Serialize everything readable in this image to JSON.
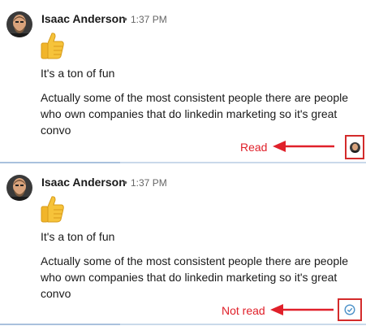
{
  "messages": [
    {
      "sender": "Isaac Anderson",
      "separator": "•",
      "time": "1:37 PM",
      "emoji_icon": "thumbs-up-icon",
      "line1": "It's a ton of fun",
      "line2": "Actually some of the most consistent people there are people who own companies that do linkedin marketing so it's great convo",
      "annotation": "Read",
      "receipt_icon": "read-receipt-avatar-icon"
    },
    {
      "sender": "Isaac Anderson",
      "separator": "•",
      "time": "1:37 PM",
      "emoji_icon": "thumbs-up-icon",
      "line1": "It's a ton of fun",
      "line2": "Actually some of the most consistent people there are people who own companies that do linkedin marketing so it's great convo",
      "annotation": "Not read",
      "receipt_icon": "sent-check-icon"
    }
  ],
  "colors": {
    "annotation_red": "#e0202a",
    "box_red": "#d32b2b",
    "divider": "#c9d9ea",
    "sent_blue": "#4a90c8"
  }
}
